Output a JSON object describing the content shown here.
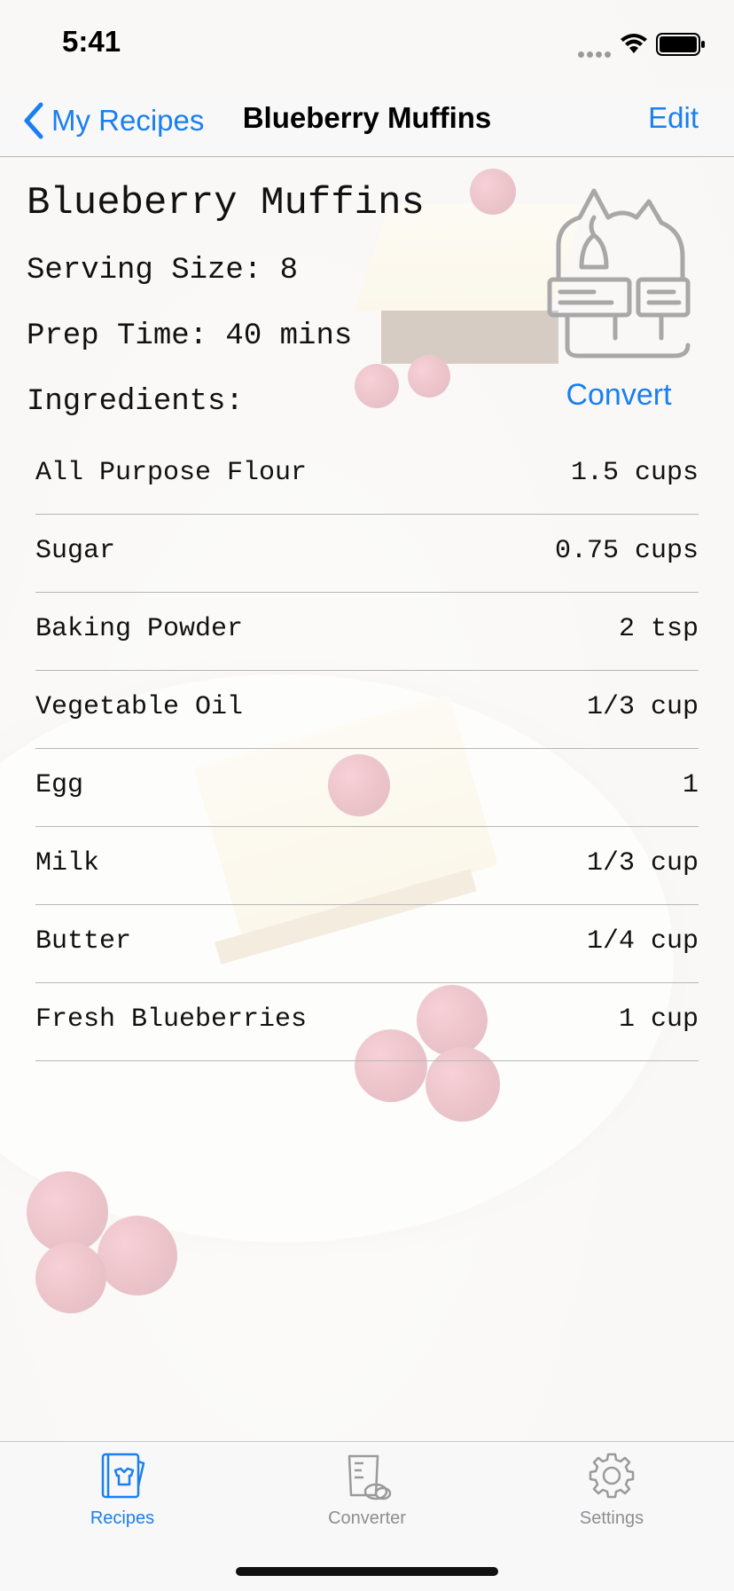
{
  "status": {
    "time": "5:41"
  },
  "nav": {
    "back_label": "My Recipes",
    "title": "Blueberry Muffins",
    "edit_label": "Edit"
  },
  "recipe": {
    "name": "Blueberry Muffins",
    "serving": "Serving Size: 8",
    "prep": "Prep Time: 40 mins",
    "ingredients_label": "Ingredients:",
    "convert_label": "Convert",
    "ingredients": [
      {
        "name": "All Purpose Flour",
        "qty": "1.5 cups"
      },
      {
        "name": "Sugar",
        "qty": "0.75 cups"
      },
      {
        "name": "Baking Powder",
        "qty": "2 tsp"
      },
      {
        "name": "Vegetable Oil",
        "qty": "1/3 cup"
      },
      {
        "name": "Egg",
        "qty": "1"
      },
      {
        "name": "Milk",
        "qty": "1/3 cup"
      },
      {
        "name": "Butter",
        "qty": "1/4 cup"
      },
      {
        "name": "Fresh Blueberries",
        "qty": "1 cup"
      }
    ]
  },
  "tabs": [
    {
      "label": "Recipes",
      "icon": "recipe-book-icon",
      "active": true
    },
    {
      "label": "Converter",
      "icon": "measuring-cup-icon",
      "active": false
    },
    {
      "label": "Settings",
      "icon": "gear-icon",
      "active": false
    }
  ],
  "colors": {
    "accent": "#1a7ff0",
    "inactive": "#8e8e93"
  }
}
